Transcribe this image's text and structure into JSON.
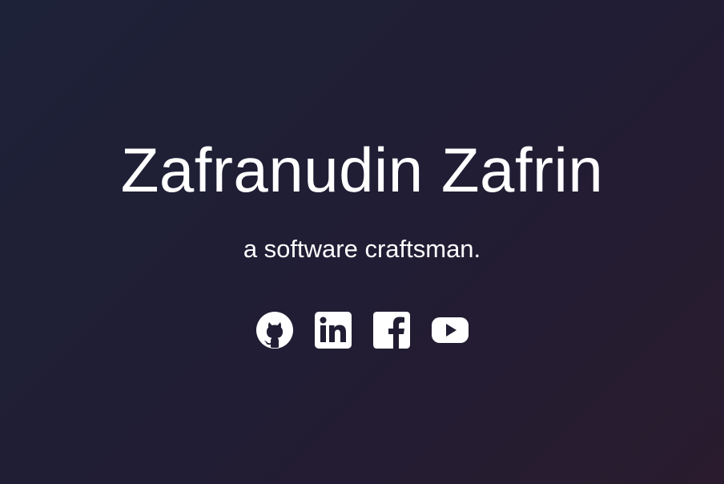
{
  "hero": {
    "name": "Zafranudin Zafrin",
    "tagline": "a software craftsman."
  },
  "socials": [
    {
      "icon": "github-icon"
    },
    {
      "icon": "linkedin-icon"
    },
    {
      "icon": "facebook-icon"
    },
    {
      "icon": "youtube-icon"
    }
  ],
  "colors": {
    "background_start": "#1e2238",
    "background_end": "#2a1b2e",
    "text": "#ffffff"
  }
}
